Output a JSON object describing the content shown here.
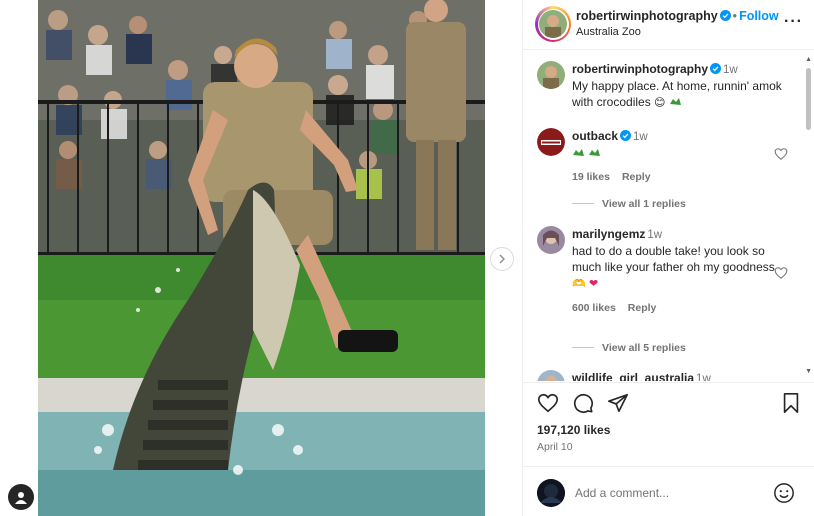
{
  "post": {
    "username": "robertirwinphotography",
    "follow_label": "Follow",
    "location": "Australia Zoo",
    "caption": "My happy place. At home, runnin' amok with crocodiles",
    "caption_time": "1w",
    "likes": "197,120 likes",
    "date": "April 10"
  },
  "comments": [
    {
      "username": "outback",
      "time": "1w",
      "text": "",
      "likes": "19 likes",
      "reply": "Reply",
      "view_replies": "View all 1 replies"
    },
    {
      "username": "marilyngemz",
      "time": "1w",
      "text": "had to do a double take! you look so much like your father oh my goodness",
      "likes": "600 likes",
      "reply": "Reply",
      "view_replies": "View all 5 replies"
    },
    {
      "username": "wildlife_girl_australia",
      "time": "1w"
    }
  ],
  "add_comment": {
    "placeholder": "Add a comment..."
  },
  "colors": {
    "accent": "#0095f6",
    "verified": "#0095f6",
    "outback_brand": "#8b1a1a"
  },
  "icons": [
    "more-options-icon",
    "heart-icon",
    "comment-icon",
    "share-icon",
    "save-icon",
    "emoji-icon",
    "next-arrow-icon",
    "verified-icon"
  ]
}
